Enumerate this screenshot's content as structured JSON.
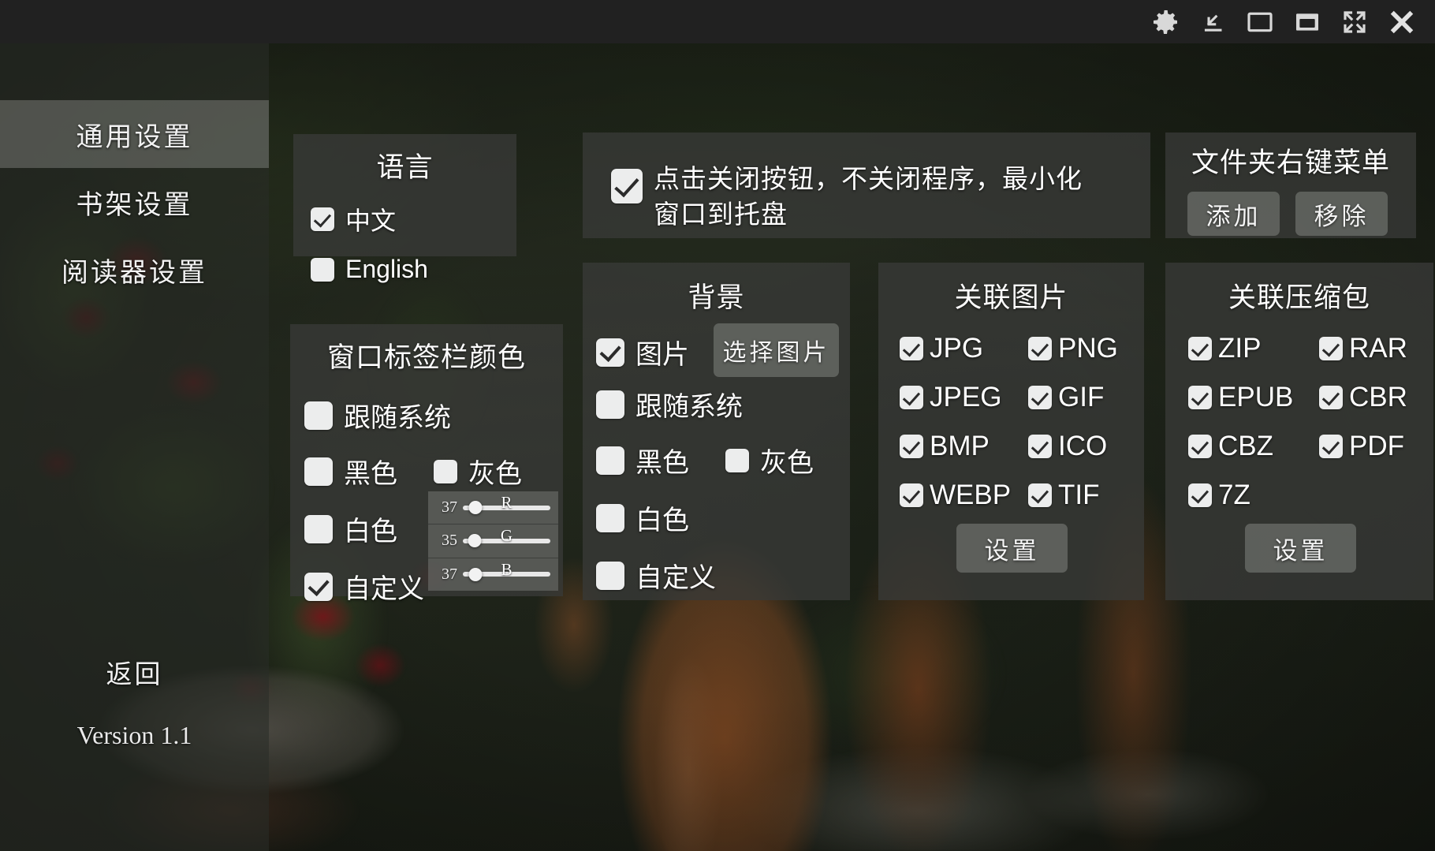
{
  "titlebar": {
    "icons": [
      {
        "name": "gear-icon",
        "label": "设置"
      },
      {
        "name": "minimize-to-tray-icon",
        "label": "最小化到托盘"
      },
      {
        "name": "restore-window-icon",
        "label": "还原"
      },
      {
        "name": "maximize-window-icon",
        "label": "最大化"
      },
      {
        "name": "fullscreen-icon",
        "label": "全屏"
      },
      {
        "name": "close-icon",
        "label": "关闭"
      }
    ]
  },
  "sidebar": {
    "items": [
      {
        "label": "通用设置",
        "active": true
      },
      {
        "label": "书架设置",
        "active": false
      },
      {
        "label": "阅读器设置",
        "active": false
      }
    ],
    "back_label": "返回",
    "version_label": "Version 1.1"
  },
  "language_panel": {
    "title": "语言",
    "options": [
      {
        "label": "中文",
        "checked": true
      },
      {
        "label": "English",
        "checked": false
      }
    ]
  },
  "tray_panel": {
    "checked": true,
    "label": "点击关闭按钮，不关闭程序，最小化窗口到托盘"
  },
  "context_menu_panel": {
    "title": "文件夹右键菜单",
    "add_label": "添加",
    "remove_label": "移除"
  },
  "titlebar_color_panel": {
    "title": "窗口标签栏颜色",
    "options": [
      {
        "label": "跟随系统",
        "checked": false
      },
      {
        "label": "黑色",
        "checked": false
      },
      {
        "label": "灰色",
        "checked": false
      },
      {
        "label": "白色",
        "checked": false
      },
      {
        "label": "自定义",
        "checked": true
      }
    ],
    "sliders": [
      {
        "channel": "R",
        "value": "37",
        "percent": 14.5
      },
      {
        "channel": "G",
        "value": "35",
        "percent": 13.7
      },
      {
        "channel": "B",
        "value": "37",
        "percent": 14.5
      }
    ]
  },
  "background_panel": {
    "title": "背景",
    "choose_image_label": "选择图片",
    "options": [
      {
        "label": "图片",
        "checked": true
      },
      {
        "label": "跟随系统",
        "checked": false
      },
      {
        "label": "黑色",
        "checked": false
      },
      {
        "label": "灰色",
        "checked": false
      },
      {
        "label": "白色",
        "checked": false
      },
      {
        "label": "自定义",
        "checked": false
      }
    ]
  },
  "image_assoc_panel": {
    "title": "关联图片",
    "settings_label": "设置",
    "formats": [
      {
        "label": "JPG",
        "checked": true
      },
      {
        "label": "PNG",
        "checked": true
      },
      {
        "label": "JPEG",
        "checked": true
      },
      {
        "label": "GIF",
        "checked": true
      },
      {
        "label": "BMP",
        "checked": true
      },
      {
        "label": "ICO",
        "checked": true
      },
      {
        "label": "WEBP",
        "checked": true
      },
      {
        "label": "TIF",
        "checked": true
      }
    ]
  },
  "archive_assoc_panel": {
    "title": "关联压缩包",
    "settings_label": "设置",
    "formats": [
      {
        "label": "ZIP",
        "checked": true
      },
      {
        "label": "RAR",
        "checked": true
      },
      {
        "label": "EPUB",
        "checked": true
      },
      {
        "label": "CBR",
        "checked": true
      },
      {
        "label": "CBZ",
        "checked": true
      },
      {
        "label": "PDF",
        "checked": true
      },
      {
        "label": "7Z",
        "checked": true
      }
    ]
  },
  "colors": {
    "titlebar_bg": "#212121",
    "panel_bg": "rgba(56,57,55,0.80)",
    "accent_text": "#ffffff",
    "checkbox_fill": "#eceded",
    "button_bg": "rgba(120,122,118,0.62)",
    "sidebar_active": "rgba(188,190,186,0.30)"
  }
}
